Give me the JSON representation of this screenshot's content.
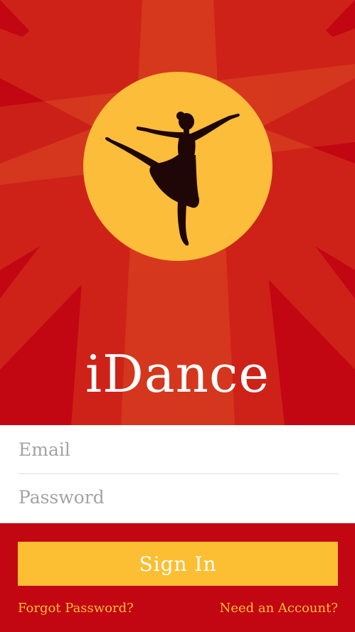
{
  "app": {
    "title": "iDance"
  },
  "login_form": {
    "email_placeholder": "Email",
    "password_placeholder": "Password"
  },
  "actions": {
    "sign_in_label": "Sign In",
    "forgot_password_label": "Forgot Password?",
    "need_account_label": "Need an Account?"
  },
  "theme": {
    "background": "#c20612",
    "accent": "#fcbf33",
    "spotlight": "#e8561c",
    "sun": "#fbbd3a",
    "silhouette": "#1f0707",
    "text_light": "#ffffff",
    "placeholder": "#a3a3a3"
  },
  "icons": {
    "hero_illustration": "ballerina-silhouette-icon"
  }
}
